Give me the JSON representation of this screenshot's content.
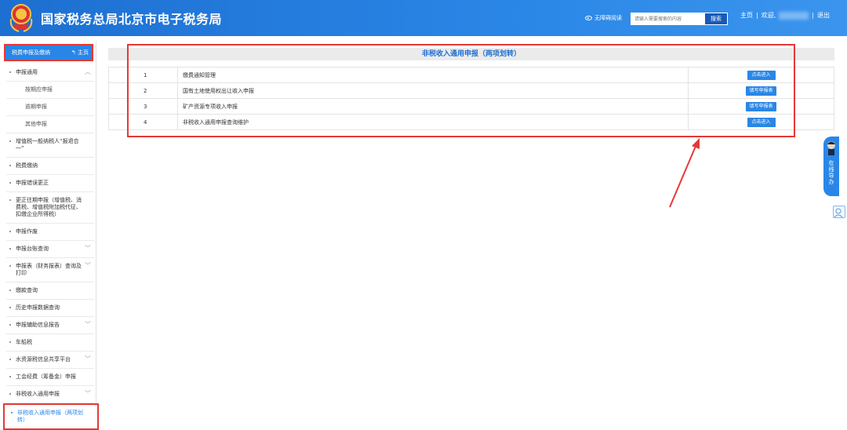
{
  "header": {
    "title": "国家税务总局北京市电子税务局",
    "accessibility": "无障碍阅读",
    "search_placeholder": "请输入需要搜索的内容",
    "search_button": "搜索",
    "home": "主页",
    "separator": "|",
    "welcome": "欢迎,",
    "logout": "退出"
  },
  "sidebar": {
    "header": "税费申报及缴纳",
    "home": "主页",
    "items": [
      {
        "label": "申报通用"
      },
      {
        "label": "按期应申报"
      },
      {
        "label": "逾期申报"
      },
      {
        "label": "其他申报"
      },
      {
        "label": "增值税一般纳税人“报退合一”"
      },
      {
        "label": "税费缴纳"
      },
      {
        "label": "申报错误更正"
      },
      {
        "label": "更正往期申报（增值税、消费税、增值税附加税代征、扣缴企业所得税）"
      },
      {
        "label": "申报作废"
      },
      {
        "label": "申报台账查询"
      },
      {
        "label": "申报表（财务报表）查询及打印"
      },
      {
        "label": "缴款查询"
      },
      {
        "label": "历史申报数据查询"
      },
      {
        "label": "申报辅助信息报告"
      },
      {
        "label": "车船税"
      },
      {
        "label": "水资源税信息共享平台"
      },
      {
        "label": "工会经费（筹备金）申报"
      },
      {
        "label": "非税收入通用申报"
      },
      {
        "label": "非税收入通用申报（两项划转）"
      }
    ]
  },
  "main": {
    "title": "非税收入通用申报（两项划转）",
    "rows": [
      {
        "num": "1",
        "name": "缴费通知管理",
        "action": "点击进入"
      },
      {
        "num": "2",
        "name": "国有土地使用权出让收入申报",
        "action": "填写申报表"
      },
      {
        "num": "3",
        "name": "矿产资源专项收入申报",
        "action": "填写申报表"
      },
      {
        "num": "4",
        "name": "非税收入通用申报查询维护",
        "action": "点击进入"
      }
    ]
  },
  "float": {
    "online": "在线导办"
  },
  "colors": {
    "primary": "#2a86e6",
    "highlight": "#e53935"
  }
}
